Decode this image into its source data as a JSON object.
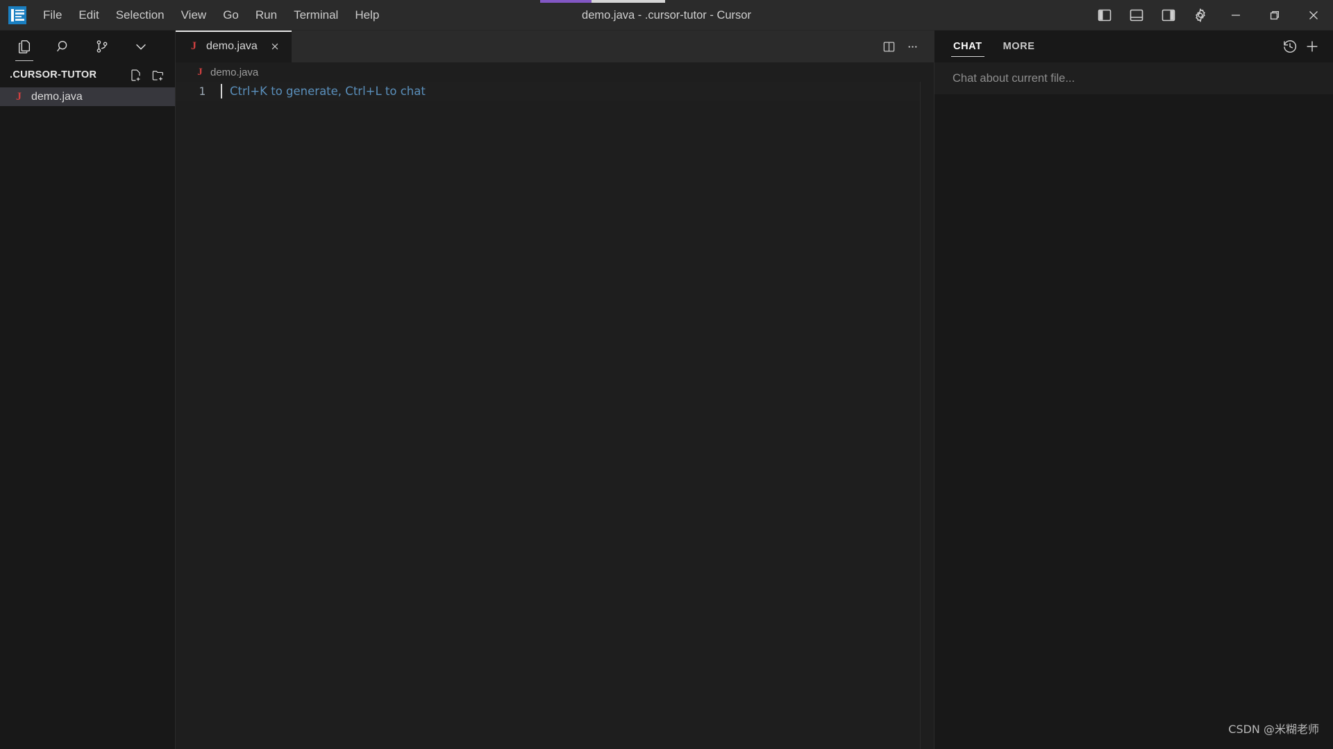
{
  "window": {
    "title": "demo.java - .cursor-tutor - Cursor",
    "logo_icon": "cursor-app-logo-icon",
    "accent_color": "#8257c4"
  },
  "menubar": {
    "items": [
      {
        "label": "File"
      },
      {
        "label": "Edit"
      },
      {
        "label": "Selection"
      },
      {
        "label": "View"
      },
      {
        "label": "Go"
      },
      {
        "label": "Run"
      },
      {
        "label": "Terminal"
      },
      {
        "label": "Help"
      }
    ]
  },
  "titlebar_actions": {
    "toggle_primary_sidebar": "layout-panel-left-icon",
    "toggle_bottom_panel": "layout-panel-bottom-icon",
    "toggle_secondary_sidebar": "layout-panel-right-icon",
    "settings": "gear-icon",
    "minimize": "minimize-icon",
    "maximize": "maximize-restore-icon",
    "close": "close-icon"
  },
  "sidebar": {
    "activity_items": [
      {
        "name": "explorer",
        "icon": "files-icon",
        "active": true
      },
      {
        "name": "search",
        "icon": "search-icon",
        "active": false
      },
      {
        "name": "source-control",
        "icon": "source-control-icon",
        "active": false
      },
      {
        "name": "more-views",
        "icon": "chevron-down-icon",
        "active": false
      }
    ],
    "folder": {
      "name": ".CURSOR-TUTOR",
      "actions": [
        {
          "name": "new-file",
          "icon": "new-file-icon"
        },
        {
          "name": "new-folder",
          "icon": "new-folder-icon"
        }
      ]
    },
    "files": [
      {
        "name": "demo.java",
        "icon": "java-file-icon",
        "selected": true
      }
    ]
  },
  "editor": {
    "tabs": [
      {
        "label": "demo.java",
        "icon": "java-file-icon",
        "active": true,
        "close_icon": "close-icon"
      }
    ],
    "actions": [
      {
        "name": "split-editor-right",
        "icon": "split-editor-icon"
      },
      {
        "name": "more-editor-actions",
        "icon": "ellipsis-icon"
      }
    ],
    "breadcrumb": {
      "icon": "java-file-icon",
      "label": "demo.java"
    },
    "lines": [
      {
        "number": "1",
        "ghost_text": "Ctrl+K to generate, Ctrl+L to chat"
      }
    ]
  },
  "chat": {
    "tabs": [
      {
        "label": "CHAT",
        "active": true
      },
      {
        "label": "MORE",
        "active": false
      }
    ],
    "actions": [
      {
        "name": "chat-history",
        "icon": "history-icon"
      },
      {
        "name": "new-chat",
        "icon": "plus-icon"
      }
    ],
    "input_placeholder": "Chat about current file..."
  },
  "watermark": {
    "text": "CSDN @米糊老师"
  }
}
